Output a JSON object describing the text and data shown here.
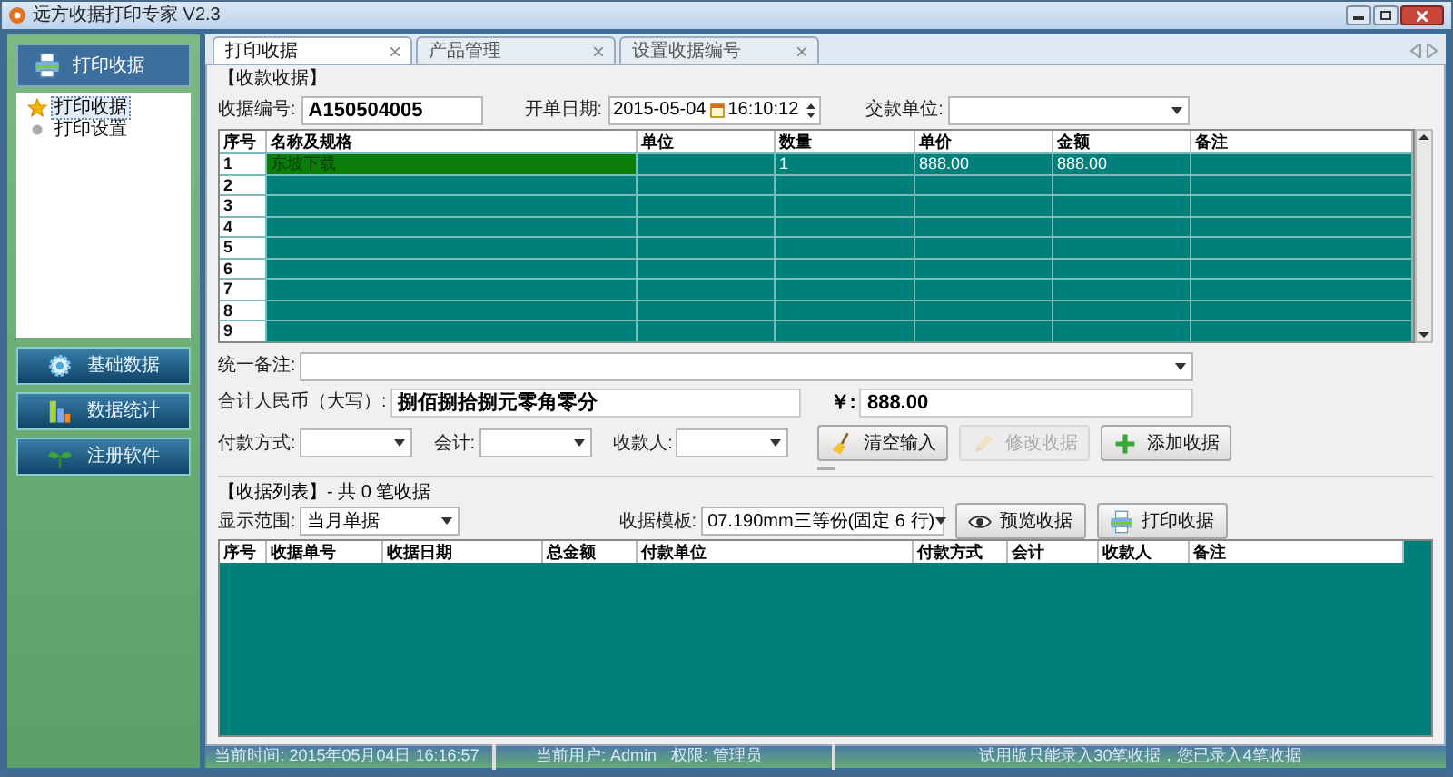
{
  "window": {
    "title": "远方收据打印专家 V2.3"
  },
  "sidebar": {
    "header": "打印收据",
    "tree": [
      {
        "label": "打印收据",
        "selected": true,
        "kind": "star"
      },
      {
        "label": "打印设置",
        "selected": false,
        "kind": "dot"
      }
    ],
    "buttons": [
      {
        "label": "基础数据",
        "kind": "gear"
      },
      {
        "label": "数据统计",
        "kind": "chart"
      },
      {
        "label": "注册软件",
        "kind": "sprout"
      }
    ]
  },
  "tabs": [
    {
      "label": "打印收据",
      "selected": true
    },
    {
      "label": "产品管理",
      "selected": false
    },
    {
      "label": "设置收据编号",
      "selected": false
    }
  ],
  "receipt": {
    "section_title": "【收款收据】",
    "number_label": "收据编号:",
    "number": "A150504005",
    "date_label": "开单日期:",
    "date": "2015-05-04",
    "time": "16:10:12",
    "payer_label": "交款单位:",
    "columns": [
      "序号",
      "名称及规格",
      "单位",
      "数量",
      "单价",
      "金额",
      "备注"
    ],
    "rows": [
      {
        "cells": [
          "1",
          "东坡下载",
          "",
          "1",
          "888.00",
          "888.00",
          ""
        ],
        "selected": true
      },
      {
        "cells": [
          "2",
          "",
          "",
          "",
          "",
          "",
          ""
        ],
        "selected": false
      },
      {
        "cells": [
          "3",
          "",
          "",
          "",
          "",
          "",
          ""
        ],
        "selected": false
      },
      {
        "cells": [
          "4",
          "",
          "",
          "",
          "",
          "",
          ""
        ],
        "selected": false
      },
      {
        "cells": [
          "5",
          "",
          "",
          "",
          "",
          "",
          ""
        ],
        "selected": false
      },
      {
        "cells": [
          "6",
          "",
          "",
          "",
          "",
          "",
          ""
        ],
        "selected": false
      },
      {
        "cells": [
          "7",
          "",
          "",
          "",
          "",
          "",
          ""
        ],
        "selected": false
      },
      {
        "cells": [
          "8",
          "",
          "",
          "",
          "",
          "",
          ""
        ],
        "selected": false
      },
      {
        "cells": [
          "9",
          "",
          "",
          "",
          "",
          "",
          ""
        ],
        "selected": false
      }
    ],
    "remark_label": "统一备注:",
    "total_label": "合计人民币（大写）:",
    "total_words": "捌佰捌拾捌元零角零分",
    "yen_label": "￥:",
    "total": "888.00",
    "payment_label": "付款方式:",
    "accountant_label": "会计:",
    "payee_label": "收款人:",
    "buttons": [
      {
        "label": "清空输入",
        "kind": "broom",
        "disabled": false
      },
      {
        "label": "修改收据",
        "kind": "pencil",
        "disabled": true
      },
      {
        "label": "添加收据",
        "kind": "plus",
        "disabled": false
      }
    ]
  },
  "list": {
    "title": "【收据列表】- 共 0 笔收据",
    "range_label": "显示范围:",
    "range": "当月单据",
    "template_label": "收据模板:",
    "template": "07.190mm三等份(固定 6 行)",
    "buttons": [
      {
        "label": "预览收据",
        "kind": "eye",
        "disabled": false
      },
      {
        "label": "打印收据",
        "kind": "printer",
        "disabled": false
      }
    ],
    "columns": [
      "序号",
      "收据单号",
      "收据日期",
      "总金额",
      "付款单位",
      "付款方式",
      "会计",
      "收款人",
      "备注"
    ]
  },
  "status_bar": {
    "time": "当前时间: 2015年05月04日 16:16:57",
    "user": "当前用户: Admin",
    "role": "权限: 管理员",
    "notice": "试用版只能录入30笔收据，您已录入4笔收据"
  }
}
